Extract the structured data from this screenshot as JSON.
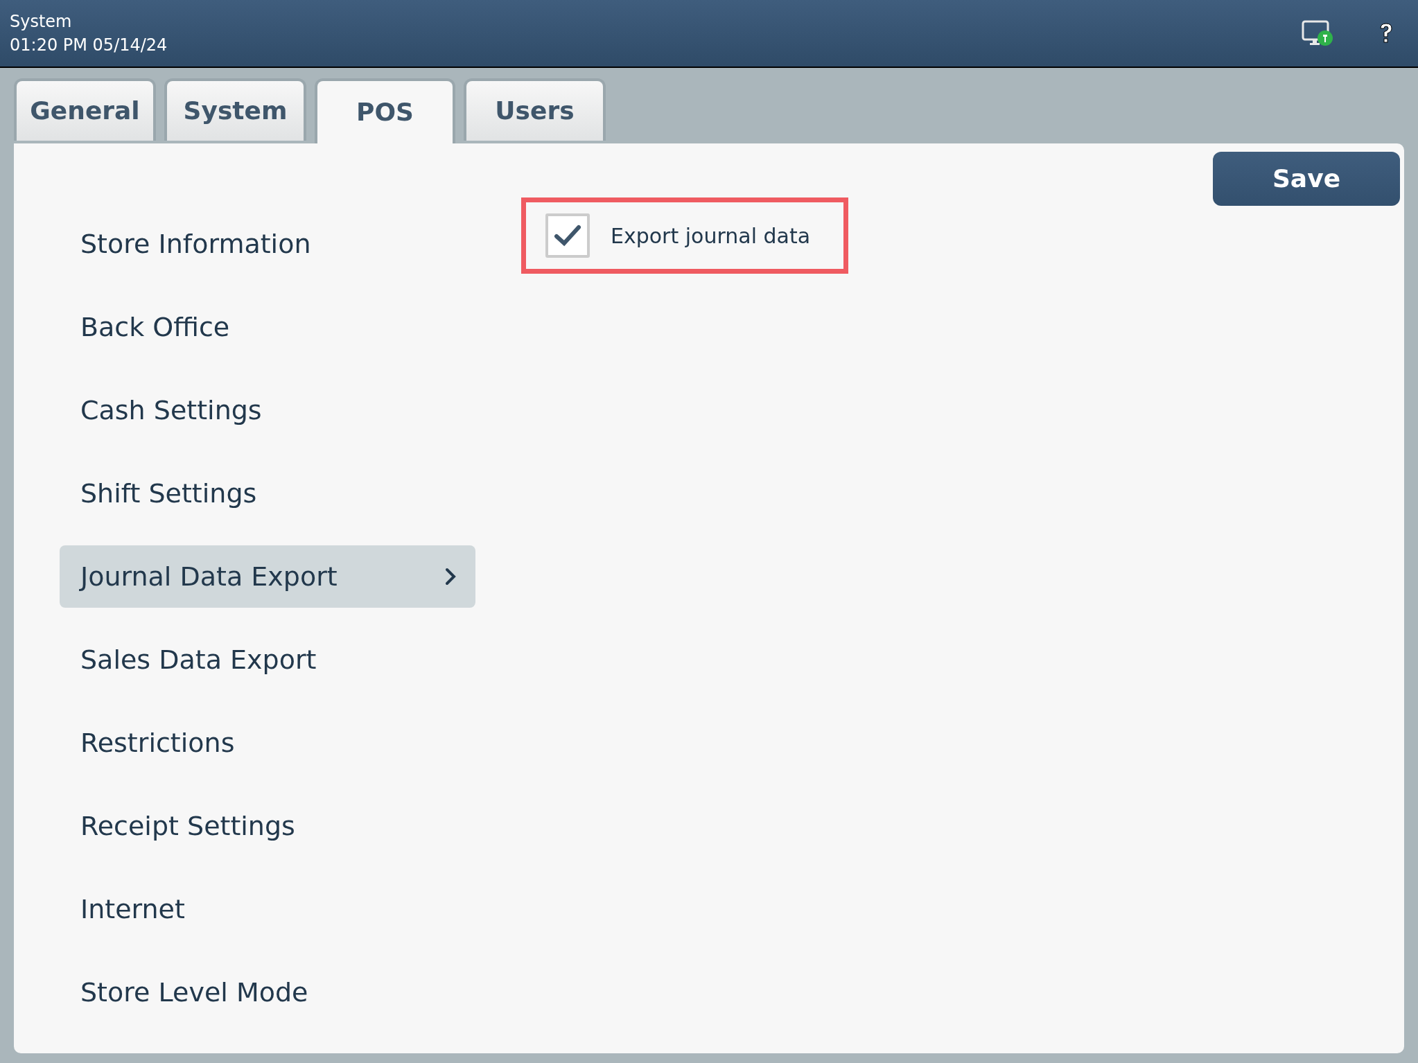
{
  "header": {
    "title": "System",
    "datetime": "01:20 PM 05/14/24"
  },
  "tabs": [
    {
      "label": "General",
      "selected": false
    },
    {
      "label": "System",
      "selected": false
    },
    {
      "label": "POS",
      "selected": true
    },
    {
      "label": "Users",
      "selected": false
    }
  ],
  "save_button": "Save",
  "sidebar": {
    "items": [
      {
        "label": "Store Information",
        "selected": false
      },
      {
        "label": "Back Office",
        "selected": false
      },
      {
        "label": "Cash Settings",
        "selected": false
      },
      {
        "label": "Shift Settings",
        "selected": false
      },
      {
        "label": "Journal Data Export",
        "selected": true
      },
      {
        "label": "Sales Data Export",
        "selected": false
      },
      {
        "label": "Restrictions",
        "selected": false
      },
      {
        "label": "Receipt Settings",
        "selected": false
      },
      {
        "label": "Internet",
        "selected": false
      },
      {
        "label": "Store Level Mode",
        "selected": false
      }
    ]
  },
  "options": [
    {
      "label": "Export journal data",
      "checked": true,
      "highlighted": true
    }
  ]
}
